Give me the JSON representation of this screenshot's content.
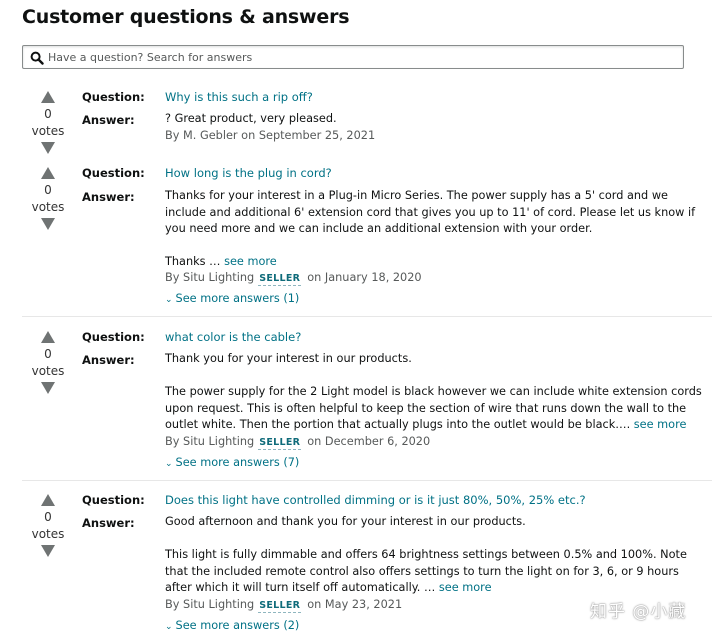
{
  "page_title": "Customer questions & answers",
  "search": {
    "placeholder": "Have a question? Search for answers"
  },
  "labels": {
    "question": "Question:",
    "answer": "Answer:",
    "votes": "votes",
    "seller_badge": "SELLER",
    "see_more": "see more"
  },
  "items": [
    {
      "votes": "0",
      "question": "Why is this such a rip off?",
      "answer_paragraphs": [
        "? Great product, very pleased."
      ],
      "byline_prefix": "By M. Gebler",
      "byline_date": "on September 25, 2021",
      "is_seller": false,
      "see_more_answers": null
    },
    {
      "votes": "0",
      "question": "How long is the plug in cord?",
      "answer_paragraphs": [
        "Thanks for your interest in a Plug-in Micro Series. The power supply has a 5' cord and we include and additional 6' extension cord that gives you up to 11' of cord. Please let us know if you need more and we can include an additional extension with your order.",
        "Thanks …"
      ],
      "byline_prefix": "By Situ Lighting",
      "byline_date": "on January 18, 2020",
      "is_seller": true,
      "see_more_answers": "See more answers (1)"
    },
    {
      "votes": "0",
      "question": "what color is the cable?",
      "answer_paragraphs": [
        "Thank you for your interest in our products.",
        "The power supply for the 2 Light model is black however we can include white extension cords upon request. This is often helpful to keep the section of wire that runs down the wall to the outlet white. Then the portion that actually plugs into the outlet would be black…."
      ],
      "byline_prefix": "By Situ Lighting",
      "byline_date": "on December 6, 2020",
      "is_seller": true,
      "see_more_answers": "See more answers (7)"
    },
    {
      "votes": "0",
      "question": "Does this light have controlled dimming or is it just 80%, 50%, 25% etc.?",
      "answer_paragraphs": [
        "Good afternoon and thank you for your interest in our products.",
        "This light is fully dimmable and offers 64 brightness settings between 0.5% and 100%. Note that the included remote control also offers settings to turn the light on for 3, 6, or 9 hours after which it will turn itself off automatically. …"
      ],
      "byline_prefix": "By Situ Lighting",
      "byline_date": "on May 23, 2021",
      "is_seller": true,
      "see_more_answers": "See more answers (2)"
    }
  ],
  "watermark": "知乎 @小藏"
}
